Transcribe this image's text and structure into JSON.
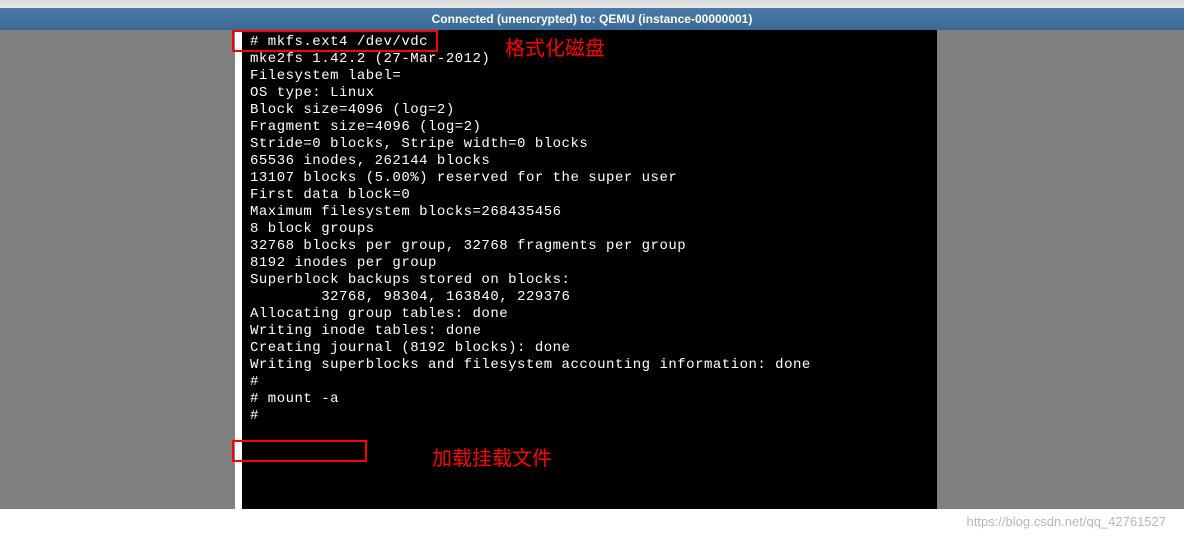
{
  "header": {
    "title": "Connected (unencrypted) to: QEMU (instance-00000001)"
  },
  "console": {
    "lines": [
      "# mkfs.ext4 /dev/vdc",
      "mke2fs 1.42.2 (27-Mar-2012)",
      "Filesystem label=",
      "OS type: Linux",
      "Block size=4096 (log=2)",
      "Fragment size=4096 (log=2)",
      "Stride=0 blocks, Stripe width=0 blocks",
      "65536 inodes, 262144 blocks",
      "13107 blocks (5.00%) reserved for the super user",
      "First data block=0",
      "Maximum filesystem blocks=268435456",
      "8 block groups",
      "32768 blocks per group, 32768 fragments per group",
      "8192 inodes per group",
      "Superblock backups stored on blocks:",
      "        32768, 98304, 163840, 229376",
      "",
      "Allocating group tables: done",
      "Writing inode tables: done",
      "Creating journal (8192 blocks): done",
      "Writing superblocks and filesystem accounting information: done",
      "",
      "#",
      "# mount -a",
      "#"
    ]
  },
  "annotations": {
    "label1": "格式化磁盘",
    "label2": "加载挂载文件"
  },
  "watermark": {
    "text": "https://blog.csdn.net/qq_42761527"
  }
}
